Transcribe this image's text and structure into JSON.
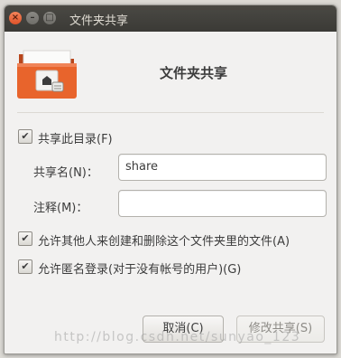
{
  "window": {
    "title": "文件夹共享"
  },
  "header": {
    "title": "文件夹共享"
  },
  "share_folder": {
    "label": "共享此目录(F)",
    "checked": true
  },
  "share_name": {
    "label": "共享名(N)：",
    "value": "share"
  },
  "comment": {
    "label": "注释(M)：",
    "value": ""
  },
  "allow_modify": {
    "label": "允许其他人来创建和删除这个文件夹里的文件(A)",
    "checked": true
  },
  "guest_access": {
    "label": "允许匿名登录(对于没有帐号的用户)(G)",
    "checked": true
  },
  "buttons": {
    "cancel": "取消(C)",
    "modify": "修改共享(S)"
  },
  "watermark": "http://blog.csdn.net/sunyao_123",
  "colors": {
    "titlebar": "#3b3a36",
    "folder": "#e8642c",
    "background": "#f2f1f0"
  }
}
